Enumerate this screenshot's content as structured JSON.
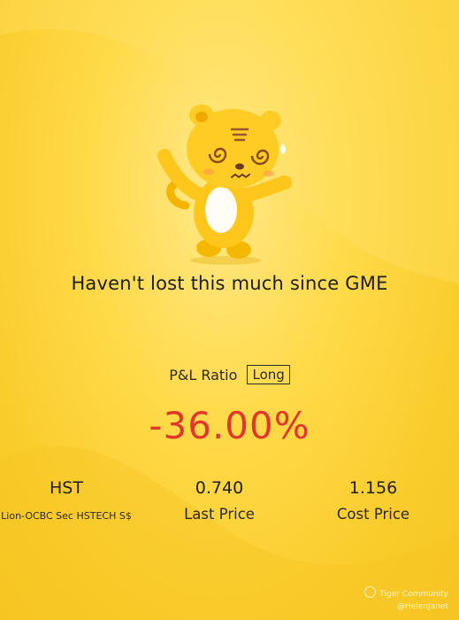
{
  "headline": "Haven't lost this much since GME",
  "pnl": {
    "label": "P&L Ratio",
    "position_badge": "Long",
    "value": "-36.00%",
    "value_color": "#e2362f"
  },
  "stats": [
    {
      "value": "HST",
      "label": "Lion-OCBC Sec HSTECH S$"
    },
    {
      "value": "0.740",
      "label": "Last Price"
    },
    {
      "value": "1.156",
      "label": "Cost Price"
    }
  ],
  "watermark": {
    "brand": "Tiger Community",
    "user": "@HelenJanet"
  },
  "mascot": {
    "icon": "tiger-mascot-dizzy-icon"
  },
  "colors": {
    "background": "#ffd93f",
    "text": "#1e1e1e",
    "loss": "#e2362f"
  }
}
